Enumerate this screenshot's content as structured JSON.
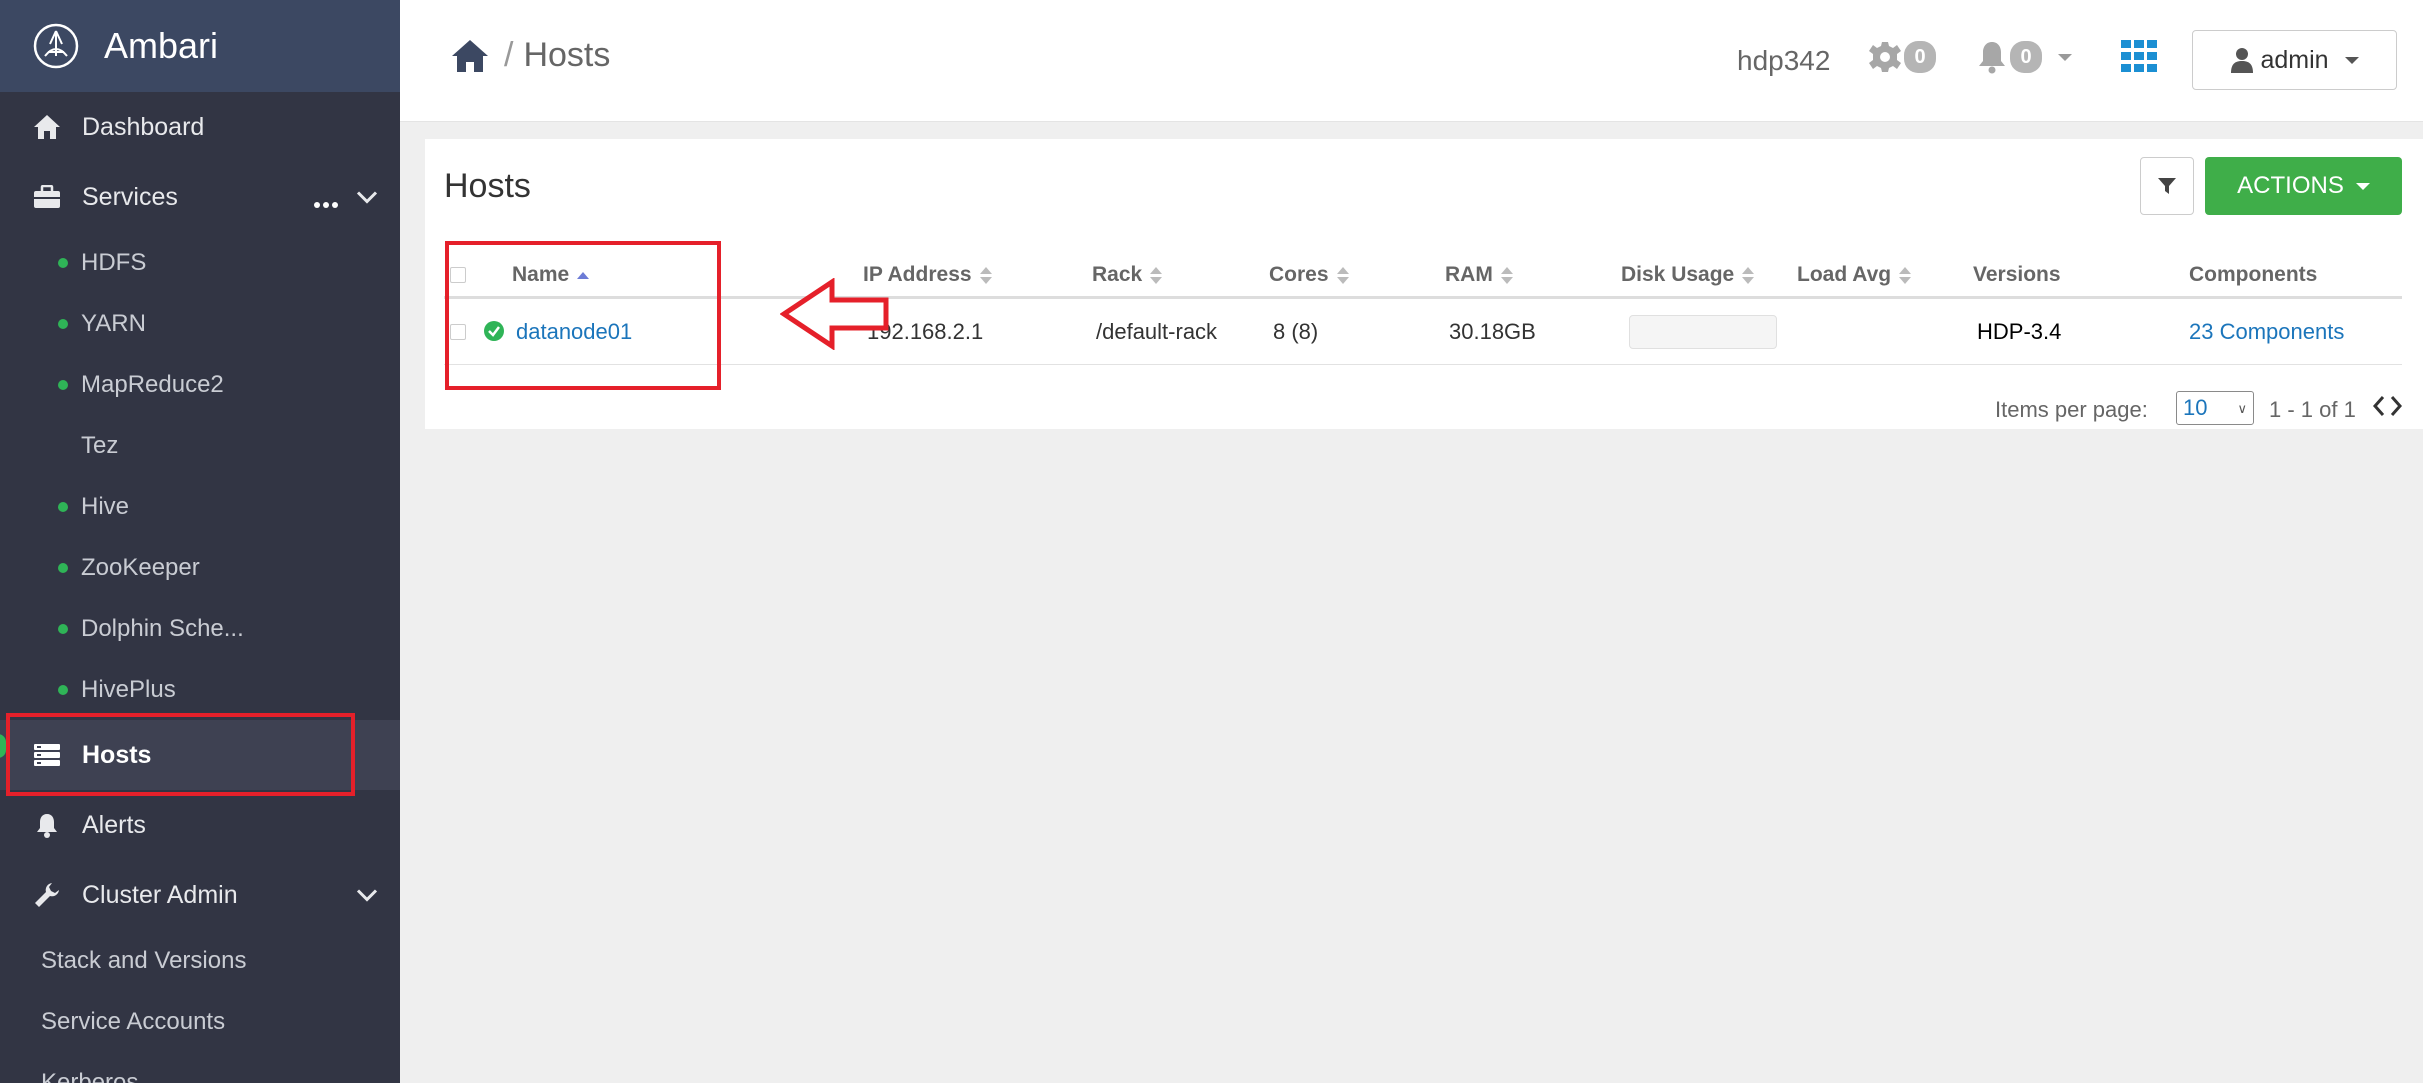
{
  "brand": {
    "name": "Ambari"
  },
  "sidebar": {
    "dashboard": "Dashboard",
    "services": "Services",
    "service_items": [
      {
        "label": "HDFS",
        "status": "green"
      },
      {
        "label": "YARN",
        "status": "green"
      },
      {
        "label": "MapReduce2",
        "status": "green"
      },
      {
        "label": "Tez",
        "status": "none"
      },
      {
        "label": "Hive",
        "status": "green"
      },
      {
        "label": "ZooKeeper",
        "status": "green"
      },
      {
        "label": "Dolphin Sche...",
        "status": "green"
      },
      {
        "label": "HivePlus",
        "status": "green"
      }
    ],
    "hosts": "Hosts",
    "alerts": "Alerts",
    "cluster_admin": "Cluster Admin",
    "cluster_admin_items": [
      "Stack and Versions",
      "Service Accounts",
      "Kerberos"
    ]
  },
  "header": {
    "breadcrumb_current": "Hosts",
    "cluster": "hdp342",
    "ops_count": "0",
    "alerts_count": "0",
    "user": "admin"
  },
  "page": {
    "title": "Hosts",
    "actions_label": "ACTIONS"
  },
  "table": {
    "columns": {
      "name": "Name",
      "ip": "IP Address",
      "rack": "Rack",
      "cores": "Cores",
      "ram": "RAM",
      "disk": "Disk Usage",
      "load": "Load Avg",
      "versions": "Versions",
      "components": "Components"
    },
    "rows": [
      {
        "name": "datanode01",
        "ip": "192.168.2.1",
        "rack": "/default-rack",
        "cores": "8 (8)",
        "ram": "30.18GB",
        "load": "",
        "version": "HDP-3.4",
        "components": "23 Components"
      }
    ]
  },
  "pagination": {
    "items_per_page_label": "Items per page:",
    "items_per_page": "10",
    "info": "1 - 1 of 1"
  },
  "colors": {
    "sidebar_bg": "#323544",
    "brand_bg": "#3c4862",
    "accent_green": "#3fae49",
    "link_blue": "#1b75bb",
    "annotation_red": "#e5202a"
  }
}
